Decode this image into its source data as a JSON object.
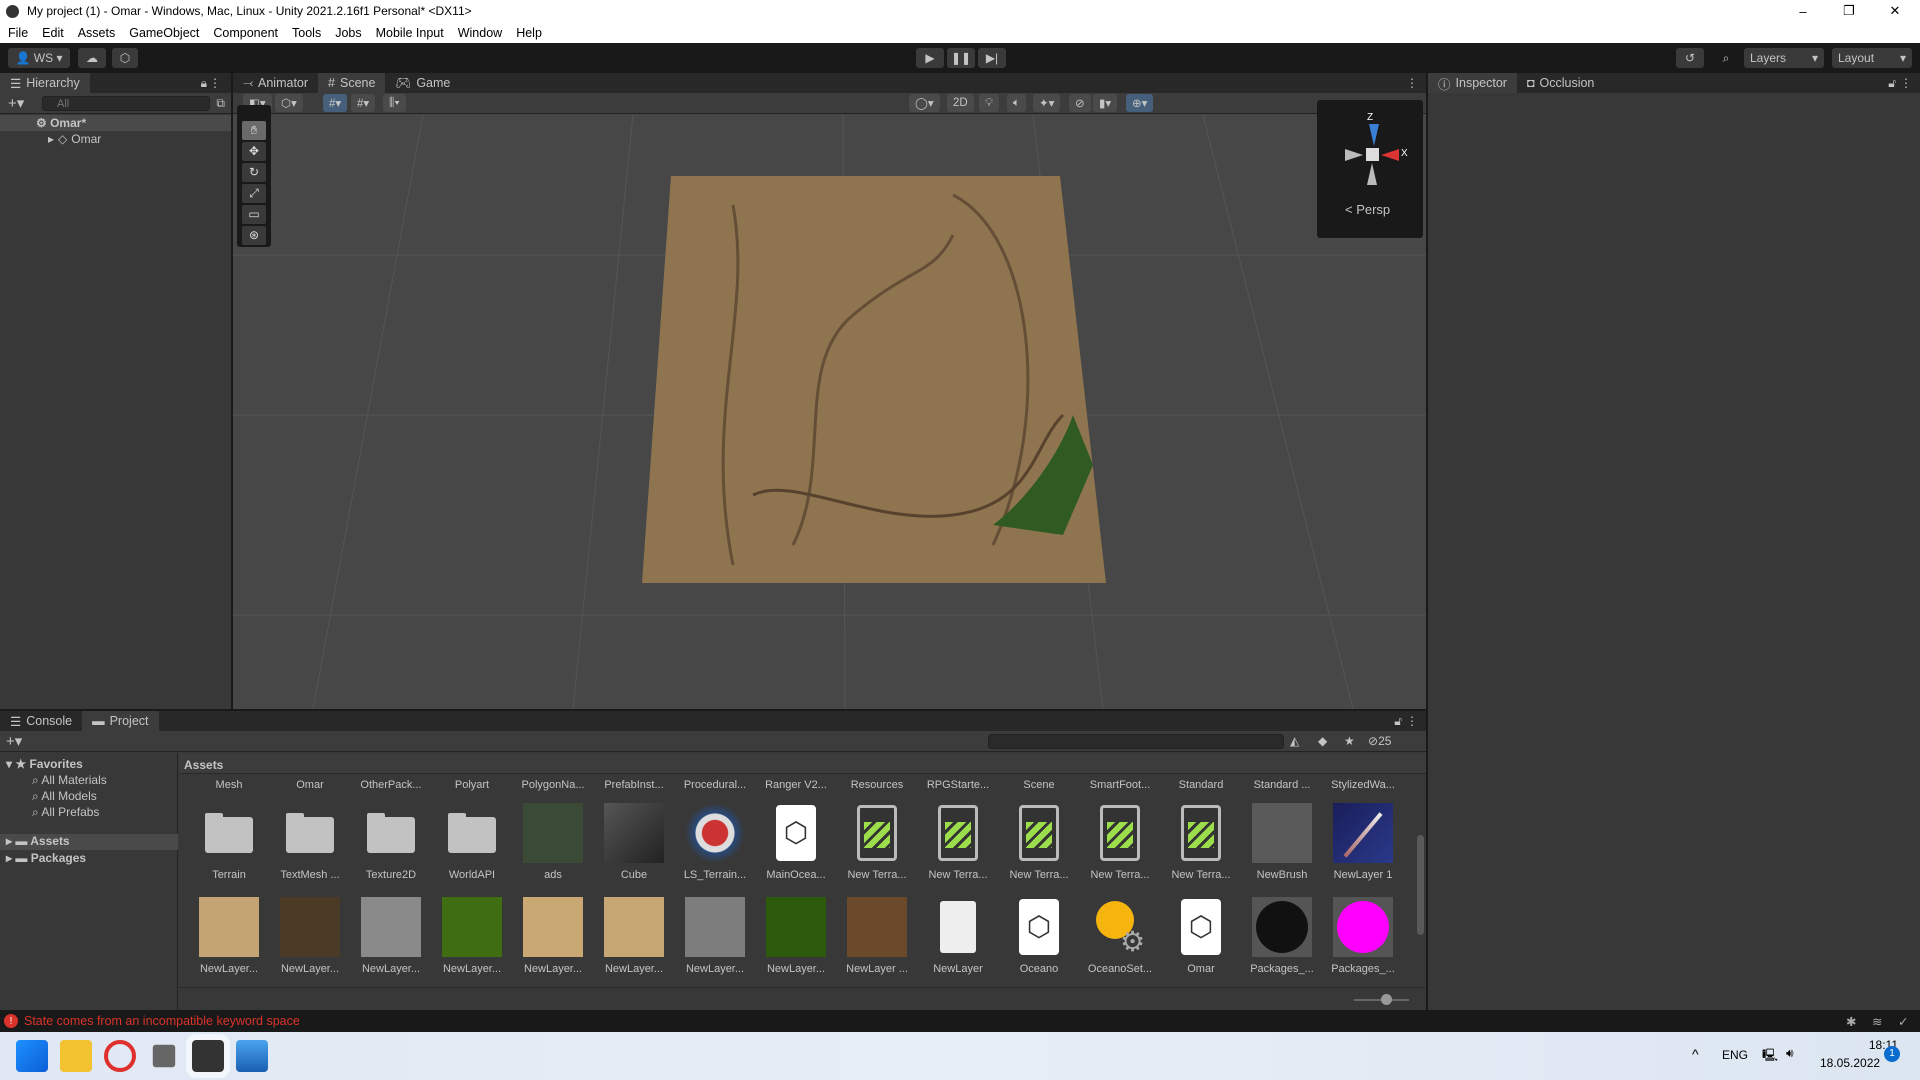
{
  "window": {
    "title": "My project (1) - Omar - Windows, Mac, Linux - Unity 2021.2.16f1 Personal* <DX11>",
    "minimize": "–",
    "maximize": "❐",
    "close": "✕"
  },
  "menu": [
    "File",
    "Edit",
    "Assets",
    "GameObject",
    "Component",
    "Tools",
    "Jobs",
    "Mobile Input",
    "Window",
    "Help"
  ],
  "toolbar": {
    "account": "WS",
    "layers": "Layers",
    "layout": "Layout"
  },
  "hierarchy": {
    "tab": "Hierarchy",
    "search_placeholder": "All",
    "scene": "Omar*",
    "child": "Omar"
  },
  "scene_tabs": [
    {
      "label": "Animator",
      "icon": "animator-icon"
    },
    {
      "label": "Scene",
      "icon": "grid-icon",
      "active": true
    },
    {
      "label": "Game",
      "icon": "gamepad-icon"
    }
  ],
  "scene": {
    "toggle_2d": "2D",
    "gizmo_persp": "< Persp",
    "gizmo_z": "Z",
    "gizmo_x": "X",
    "terrain_color": "#8f7450",
    "accent": "#46607c"
  },
  "inspector": {
    "tabs": [
      "Inspector",
      "Occlusion"
    ]
  },
  "bottom": {
    "tabs": [
      "Console",
      "Project"
    ],
    "hidden_count": "25"
  },
  "project_tree": {
    "favorites": "Favorites",
    "items": [
      "All Materials",
      "All Models",
      "All Prefabs"
    ],
    "roots": [
      "Assets",
      "Packages"
    ]
  },
  "assets": {
    "breadcrumb": "Assets",
    "top_labels": [
      "Mesh",
      "Omar",
      "OtherPack...",
      "Polyart",
      "PolygonNa...",
      "PrefabInst...",
      "Procedural...",
      "Ranger V2...",
      "Resources",
      "RPGStarte...",
      "Scene",
      "SmartFoot...",
      "Standard",
      "Standard ...",
      "StylizedWa..."
    ],
    "row1": [
      {
        "label": "Terrain",
        "type": "folder"
      },
      {
        "label": "TextMesh ...",
        "type": "folder"
      },
      {
        "label": "Texture2D",
        "type": "folder"
      },
      {
        "label": "WorldAPI",
        "type": "folder"
      },
      {
        "label": "ads",
        "type": "prefab-image",
        "color": "#3b4a36"
      },
      {
        "label": "Cube",
        "type": "cube"
      },
      {
        "label": "LS_Terrain...",
        "type": "gear-badge"
      },
      {
        "label": "MainOcea...",
        "type": "unity"
      },
      {
        "label": "New Terra...",
        "type": "terrain"
      },
      {
        "label": "New Terra...",
        "type": "terrain"
      },
      {
        "label": "New Terra...",
        "type": "terrain"
      },
      {
        "label": "New Terra...",
        "type": "terrain"
      },
      {
        "label": "New Terra...",
        "type": "terrain"
      },
      {
        "label": "NewBrush",
        "type": "texture",
        "color": "#5a5a5a"
      },
      {
        "label": "NewLayer 1",
        "type": "spear"
      }
    ],
    "row2": [
      {
        "label": "NewLayer...",
        "type": "texture",
        "color": "#c4a472"
      },
      {
        "label": "NewLayer...",
        "type": "texture",
        "color": "#4a3a26"
      },
      {
        "label": "NewLayer...",
        "type": "texture",
        "color": "#8a8a8a"
      },
      {
        "label": "NewLayer...",
        "type": "texture",
        "color": "#3f6e12"
      },
      {
        "label": "NewLayer...",
        "type": "texture",
        "color": "#c9a874"
      },
      {
        "label": "NewLayer...",
        "type": "texture",
        "color": "#c6a672"
      },
      {
        "label": "NewLayer...",
        "type": "texture",
        "color": "#7d7d7d"
      },
      {
        "label": "NewLayer...",
        "type": "texture",
        "color": "#2c5a0c"
      },
      {
        "label": "NewLayer ...",
        "type": "texture",
        "color": "#6b4a2c"
      },
      {
        "label": "NewLayer",
        "type": "file"
      },
      {
        "label": "Oceano",
        "type": "unity"
      },
      {
        "label": "OceanoSet...",
        "type": "settings"
      },
      {
        "label": "Omar",
        "type": "unity"
      },
      {
        "label": "Packages_...",
        "type": "sphere",
        "color": "#111111"
      },
      {
        "label": "Packages_...",
        "type": "sphere",
        "color": "#ff00ff"
      }
    ]
  },
  "status": {
    "message": "State comes from an incompatible keyword space",
    "color": "#d9332b"
  },
  "taskbar": {
    "lang": "ENG",
    "time": "18:11",
    "date": "18.05.2022",
    "notifications": "1"
  }
}
